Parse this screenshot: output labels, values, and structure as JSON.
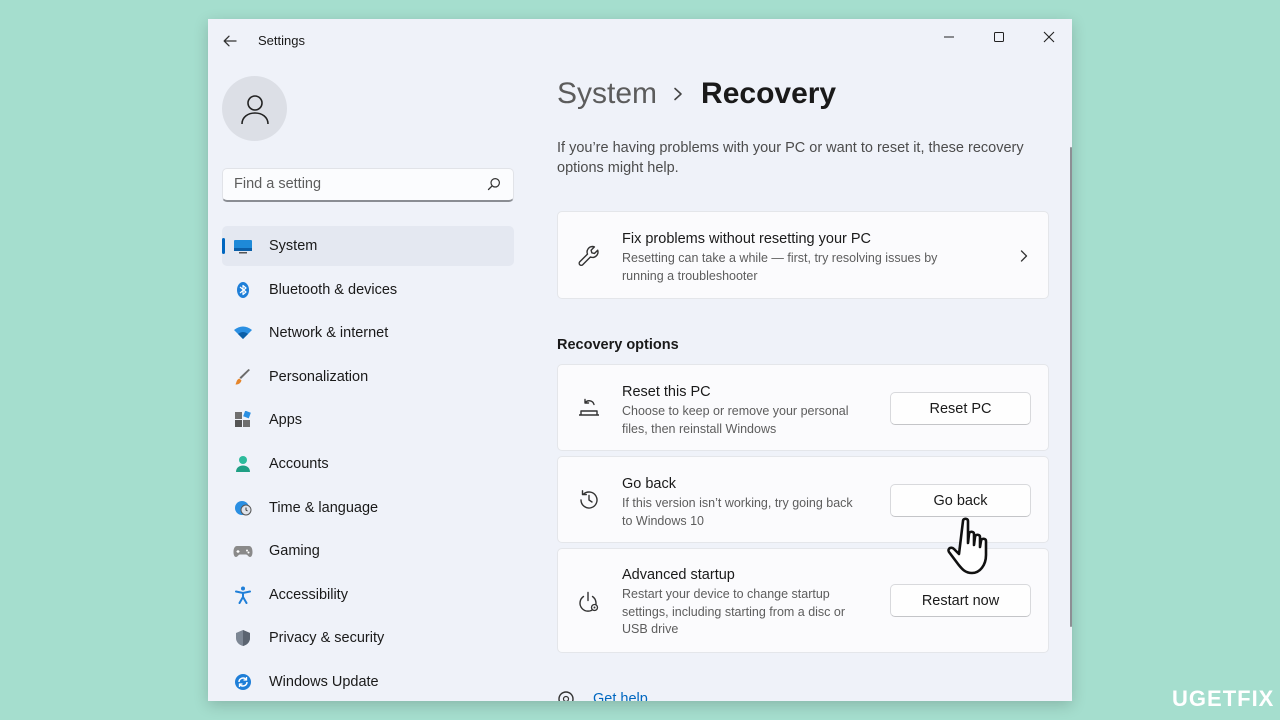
{
  "window": {
    "title": "Settings"
  },
  "sidebar": {
    "search_placeholder": "Find a setting",
    "items": [
      {
        "label": "System",
        "icon": "monitor-icon",
        "active": true
      },
      {
        "label": "Bluetooth & devices",
        "icon": "bluetooth-icon"
      },
      {
        "label": "Network & internet",
        "icon": "wifi-icon"
      },
      {
        "label": "Personalization",
        "icon": "brush-icon"
      },
      {
        "label": "Apps",
        "icon": "apps-icon"
      },
      {
        "label": "Accounts",
        "icon": "accounts-icon"
      },
      {
        "label": "Time & language",
        "icon": "globe-clock-icon"
      },
      {
        "label": "Gaming",
        "icon": "gamepad-icon"
      },
      {
        "label": "Accessibility",
        "icon": "accessibility-icon"
      },
      {
        "label": "Privacy & security",
        "icon": "shield-icon"
      },
      {
        "label": "Windows Update",
        "icon": "update-icon"
      }
    ]
  },
  "main": {
    "breadcrumb_parent": "System",
    "breadcrumb_current": "Recovery",
    "description": "If you’re having problems with your PC or want to reset it, these recovery options might help.",
    "fix_card": {
      "title": "Fix problems without resetting your PC",
      "subtitle": "Resetting can take a while — first, try resolving issues by running a troubleshooter"
    },
    "section_title": "Recovery options",
    "options": [
      {
        "title": "Reset this PC",
        "subtitle": "Choose to keep or remove your personal files, then reinstall Windows",
        "button": "Reset PC"
      },
      {
        "title": "Go back",
        "subtitle": "If this version isn’t working, try going back to Windows 10",
        "button": "Go back"
      },
      {
        "title": "Advanced startup",
        "subtitle": "Restart your device to change startup settings, including starting from a disc or USB drive",
        "button": "Restart now"
      }
    ],
    "help_link": "Get help"
  },
  "watermark": {
    "left": "UG",
    "mid": "E",
    "right": "TFIX"
  },
  "colors": {
    "accent": "#0067c0",
    "window_bg": "#eff2f9",
    "desktop_bg": "#a5dece"
  }
}
